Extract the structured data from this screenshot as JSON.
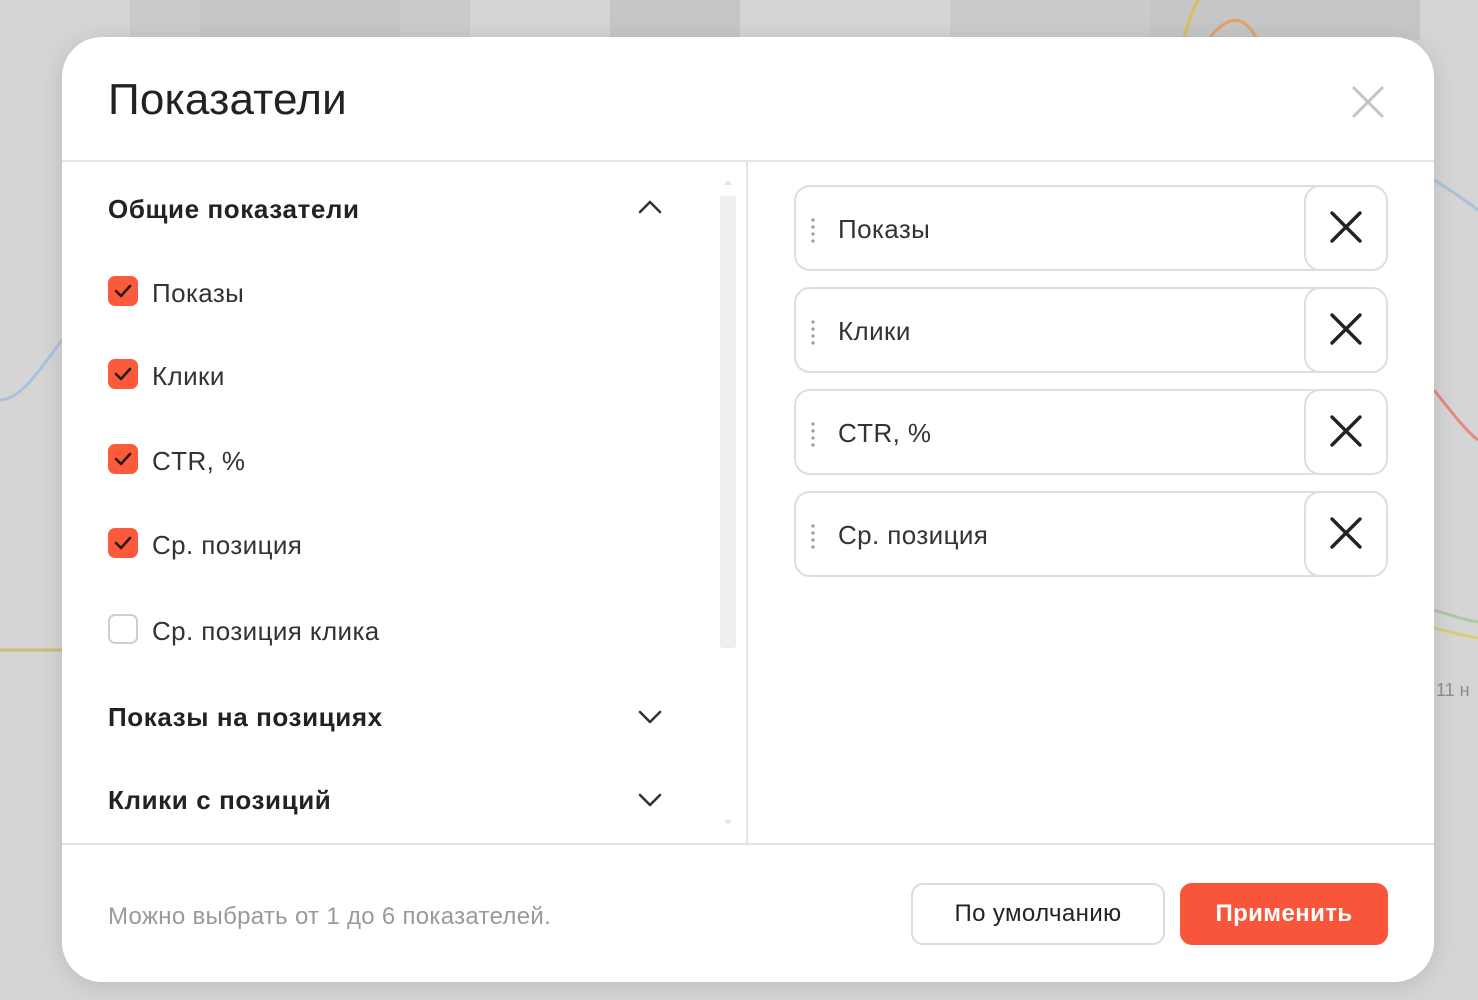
{
  "modal": {
    "title": "Показатели"
  },
  "groups": [
    {
      "title": "Общие показатели",
      "expanded": true,
      "items": [
        {
          "label": "Показы",
          "checked": true
        },
        {
          "label": "Клики",
          "checked": true
        },
        {
          "label": "CTR, %",
          "checked": true
        },
        {
          "label": "Ср. позиция",
          "checked": true
        },
        {
          "label": "Ср. позиция клика",
          "checked": false
        }
      ]
    },
    {
      "title": "Показы на позициях",
      "expanded": false
    },
    {
      "title": "Клики с позиций",
      "expanded": false
    }
  ],
  "selected": [
    {
      "label": "Показы"
    },
    {
      "label": "Клики"
    },
    {
      "label": "CTR, %"
    },
    {
      "label": "Ср. позиция"
    }
  ],
  "footer": {
    "note": "Можно выбрать от 1 до 6 показателей.",
    "default_label": "По умолчанию",
    "apply_label": "Применить"
  },
  "background": {
    "axis_label": "11 н"
  },
  "colors": {
    "accent": "#f9553b",
    "checkbox_checked": "#fc5a3c",
    "text_primary": "#222222",
    "text_muted": "#9a9a9a",
    "border": "#dedede"
  },
  "icons": {
    "close": "close-icon",
    "remove": "x-icon",
    "drag": "drag-handle-icon",
    "expanded": "chevron-up-icon",
    "collapsed": "chevron-down-icon",
    "check": "checkmark-icon"
  }
}
